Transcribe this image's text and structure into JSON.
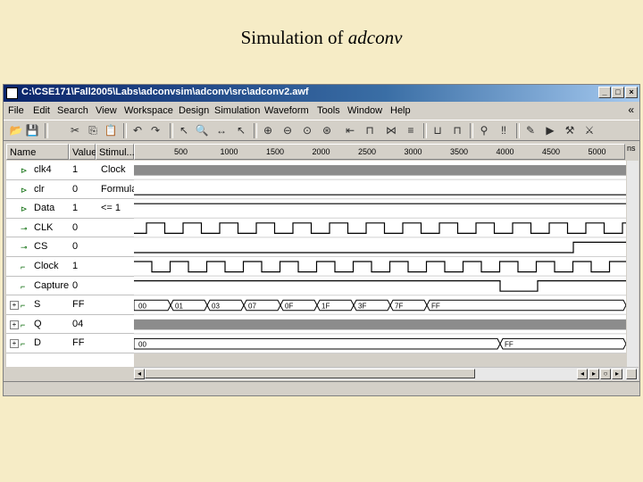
{
  "slide": {
    "title_prefix": "Simulation of ",
    "title_italic": "adconv"
  },
  "window": {
    "title": "C:\\CSE171\\Fall2005\\Labs\\adconvsim\\adconv\\src\\adconv2.awf"
  },
  "menu": [
    "File",
    "Edit",
    "Search",
    "View",
    "Workspace",
    "Design",
    "Simulation",
    "Waveform",
    "Tools",
    "Window",
    "Help"
  ],
  "menu_more": "«",
  "columns": {
    "name": "Name",
    "value": "Value",
    "stimulus": "Stimul..."
  },
  "ruler": {
    "unit": "ns",
    "ticks": [
      "500",
      "1000",
      "1500",
      "2000",
      "2500",
      "3000",
      "3500",
      "4000",
      "4500",
      "5000"
    ]
  },
  "signals": [
    {
      "name": "clk4",
      "value": "1",
      "stim": "Clock",
      "type": "bus-gray",
      "bus": false
    },
    {
      "name": "clr",
      "value": "0",
      "stim": "Formula",
      "type": "low",
      "bus": false
    },
    {
      "name": "Data",
      "value": "1",
      "stim": "<= 1",
      "type": "high",
      "bus": false
    },
    {
      "name": "CLK",
      "value": "0",
      "stim": "",
      "type": "clk",
      "bus": false
    },
    {
      "name": "CS",
      "value": "0",
      "stim": "",
      "type": "cs",
      "bus": false
    },
    {
      "name": "Clock",
      "value": "1",
      "stim": "",
      "type": "clock2",
      "bus": false
    },
    {
      "name": "Capture",
      "value": "0",
      "stim": "",
      "type": "capture",
      "bus": false
    },
    {
      "name": "S",
      "value": "FF",
      "stim": "",
      "type": "busS",
      "bus": true,
      "segments": [
        "00",
        "01",
        "03",
        "07",
        "0F",
        "1F",
        "3F",
        "7F",
        "FF"
      ]
    },
    {
      "name": "Q",
      "value": "04",
      "stim": "",
      "type": "bus-gray",
      "bus": true
    },
    {
      "name": "D",
      "value": "FF",
      "stim": "",
      "type": "busD",
      "bus": true,
      "segments": [
        "00",
        "FF"
      ]
    }
  ]
}
